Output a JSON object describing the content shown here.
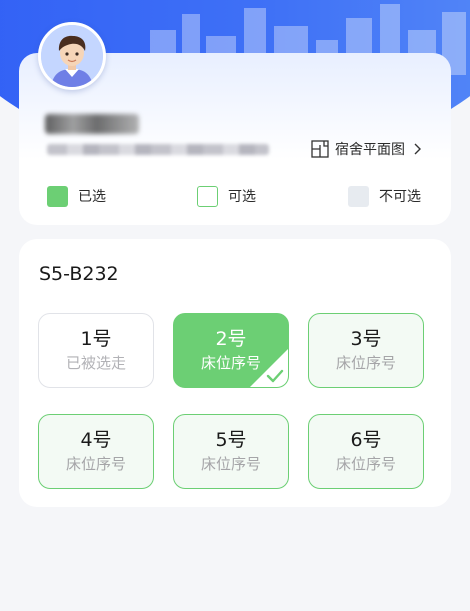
{
  "header": {
    "floorplan_link": {
      "label": "宿舍平面图",
      "icon": "floorplan-icon",
      "chevron": "chevron-right-icon"
    },
    "avatar": {
      "icon": "student-avatar-icon"
    }
  },
  "legend": {
    "selected": {
      "label": "已选",
      "color": "#6ccf74"
    },
    "available": {
      "label": "可选",
      "color": "#6ccf74"
    },
    "unavailable": {
      "label": "不可选",
      "color": "#e7ebf0"
    }
  },
  "room": {
    "title": "S5-B232",
    "beds": [
      {
        "number": "1号",
        "subtitle": "已被选走",
        "status": "taken"
      },
      {
        "number": "2号",
        "subtitle": "床位序号",
        "status": "selected"
      },
      {
        "number": "3号",
        "subtitle": "床位序号",
        "status": "available"
      },
      {
        "number": "4号",
        "subtitle": "床位序号",
        "status": "available"
      },
      {
        "number": "5号",
        "subtitle": "床位序号",
        "status": "available"
      },
      {
        "number": "6号",
        "subtitle": "床位序号",
        "status": "available"
      }
    ]
  },
  "colors": {
    "brand_blue": "#3f71f6",
    "accent_green": "#6ccf74",
    "page_bg": "#f5f6f9"
  }
}
